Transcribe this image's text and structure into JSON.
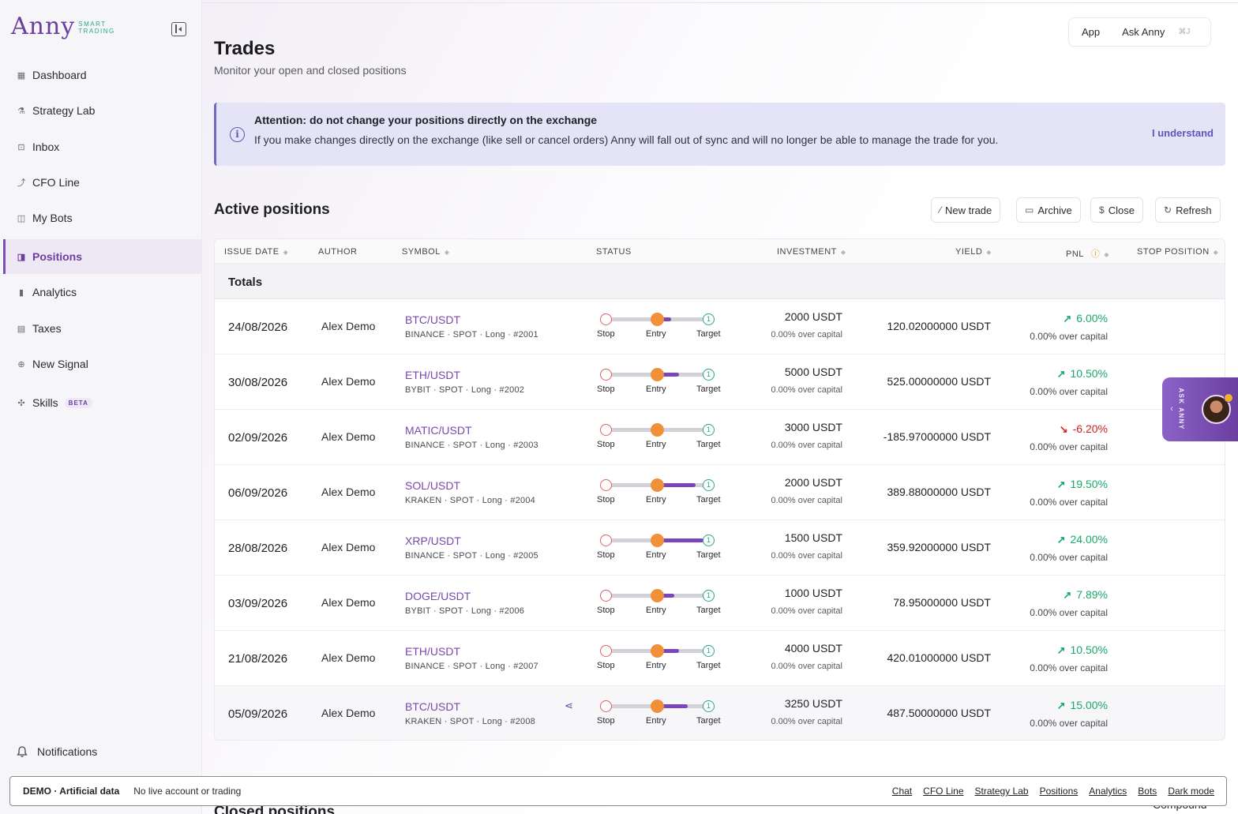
{
  "brand": {
    "name": "Anny",
    "tagline_1": "SMART",
    "tagline_2": "TRADING"
  },
  "sidebar": {
    "items": [
      {
        "label": "Dashboard",
        "icon": "grid-icon"
      },
      {
        "label": "Strategy Lab",
        "icon": "flask-icon"
      },
      {
        "label": "Inbox",
        "icon": "inbox-icon"
      },
      {
        "label": "CFO Line",
        "icon": "trend-line-icon"
      },
      {
        "label": "My Bots",
        "icon": "bot-icon"
      },
      {
        "label": "Positions",
        "icon": "briefcase-icon",
        "active": true
      },
      {
        "label": "Analytics",
        "icon": "bar-chart-icon"
      },
      {
        "label": "Taxes",
        "icon": "calculator-icon"
      },
      {
        "label": "New Signal",
        "icon": "plus-circle-icon"
      },
      {
        "label": "Skills",
        "icon": "sparkle-icon",
        "badge": "BETA"
      }
    ],
    "notifications_label": "Notifications"
  },
  "topbar": {
    "app_label": "App",
    "ask_label": "Ask Anny",
    "shortcut": "⌘J"
  },
  "page": {
    "title": "Trades",
    "subtitle": "Monitor your open and closed positions"
  },
  "alert": {
    "title": "Attention: do not change your positions directly on the exchange",
    "text": "If you make changes directly on the exchange (like sell or cancel orders) Anny will fall out of sync and will no longer be able to manage the trade for you.",
    "action": "I understand",
    "color": "#e4e4f6"
  },
  "active": {
    "title": "Active positions",
    "buttons": {
      "new_trade": "New trade",
      "archive": "Archive",
      "close": "Close",
      "refresh": "Refresh"
    },
    "columns": {
      "issue_date": "ISSUE DATE",
      "author": "AUTHOR",
      "symbol": "SYMBOL",
      "status": "STATUS",
      "investment": "INVESTMENT",
      "yield": "YIELD",
      "pnl": "PNL",
      "stop_position": "STOP POSITION"
    },
    "totals_label": "Totals",
    "status_labels": {
      "stop": "Stop",
      "entry": "Entry",
      "target": "Target",
      "target_mark": "1"
    },
    "rows": [
      {
        "date": "24/08/2026",
        "author": "Alex Demo",
        "symbol": "BTC/USDT",
        "meta": "BINANCE · SPOT · Long · #2001",
        "investment": "2000 USDT",
        "inv_sub": "0.00% over capital",
        "yield": "120.02000000 USDT",
        "pnl": "6.00%",
        "pnl_sub": "0.00% over capital",
        "dir": "up",
        "progress": 0.06
      },
      {
        "date": "30/08/2026",
        "author": "Alex Demo",
        "symbol": "ETH/USDT",
        "meta": "BYBIT · SPOT · Long · #2002",
        "investment": "5000 USDT",
        "inv_sub": "0.00% over capital",
        "yield": "525.00000000 USDT",
        "pnl": "10.50%",
        "pnl_sub": "0.00% over capital",
        "dir": "up",
        "progress": 0.105
      },
      {
        "date": "02/09/2026",
        "author": "Alex Demo",
        "symbol": "MATIC/USDT",
        "meta": "BINANCE · SPOT · Long · #2003",
        "investment": "3000 USDT",
        "inv_sub": "0.00% over capital",
        "yield": "-185.97000000 USDT",
        "pnl": "-6.20%",
        "pnl_sub": "0.00% over capital",
        "dir": "down",
        "progress": -0.062
      },
      {
        "date": "06/09/2026",
        "author": "Alex Demo",
        "symbol": "SOL/USDT",
        "meta": "KRAKEN · SPOT · Long · #2004",
        "investment": "2000 USDT",
        "inv_sub": "0.00% over capital",
        "yield": "389.88000000 USDT",
        "pnl": "19.50%",
        "pnl_sub": "0.00% over capital",
        "dir": "up",
        "progress": 0.195
      },
      {
        "date": "28/08/2026",
        "author": "Alex Demo",
        "symbol": "XRP/USDT",
        "meta": "BINANCE · SPOT · Long · #2005",
        "investment": "1500 USDT",
        "inv_sub": "0.00% over capital",
        "yield": "359.92000000 USDT",
        "pnl": "24.00%",
        "pnl_sub": "0.00% over capital",
        "dir": "up",
        "progress": 0.24
      },
      {
        "date": "03/09/2026",
        "author": "Alex Demo",
        "symbol": "DOGE/USDT",
        "meta": "BYBIT · SPOT · Long · #2006",
        "investment": "1000 USDT",
        "inv_sub": "0.00% over capital",
        "yield": "78.95000000 USDT",
        "pnl": "7.89%",
        "pnl_sub": "0.00% over capital",
        "dir": "up",
        "progress": 0.079
      },
      {
        "date": "21/08/2026",
        "author": "Alex Demo",
        "symbol": "ETH/USDT",
        "meta": "BINANCE · SPOT · Long · #2007",
        "investment": "4000 USDT",
        "inv_sub": "0.00% over capital",
        "yield": "420.01000000 USDT",
        "pnl": "10.50%",
        "pnl_sub": "0.00% over capital",
        "dir": "up",
        "progress": 0.105
      },
      {
        "date": "05/09/2026",
        "author": "Alex Demo",
        "symbol": "BTC/USDT",
        "meta": "KRAKEN · SPOT · Long · #2008",
        "investment": "3250 USDT",
        "inv_sub": "0.00% over capital",
        "yield": "487.50000000 USDT",
        "pnl": "15.00%",
        "pnl_sub": "0.00% over capital",
        "dir": "up",
        "progress": 0.15,
        "shared": true
      }
    ]
  },
  "closed": {
    "title": "Closed positions",
    "compound_label": "Compound"
  },
  "ask_tab": {
    "label": "ASK ANNY"
  },
  "demo_bar": {
    "tag": "DEMO · Artificial data",
    "note": "No live account or trading",
    "links": [
      "Chat",
      "CFO Line",
      "Strategy Lab",
      "Positions",
      "Analytics",
      "Bots",
      "Dark mode"
    ]
  },
  "colors": {
    "accent": "#6b3fa0",
    "positive": "#1aa86b",
    "negative": "#d02222",
    "entry": "#f0913a"
  }
}
